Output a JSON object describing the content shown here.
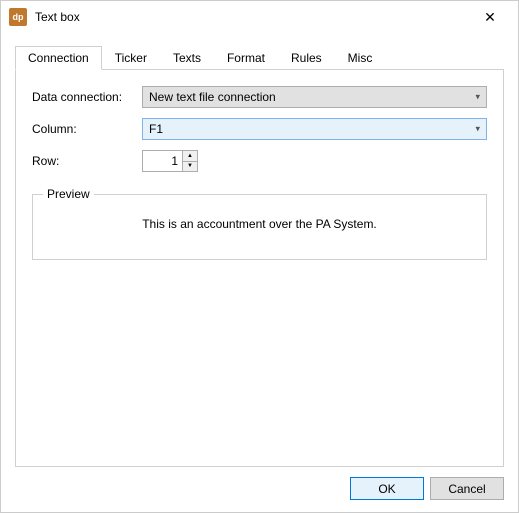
{
  "window": {
    "icon_text": "dp",
    "title": "Text box",
    "close": "✕"
  },
  "tabs": {
    "connection": "Connection",
    "ticker": "Ticker",
    "texts": "Texts",
    "format": "Format",
    "rules": "Rules",
    "misc": "Misc"
  },
  "form": {
    "data_connection_label": "Data connection:",
    "data_connection_value": "New text file connection",
    "column_label": "Column:",
    "column_value": "F1",
    "row_label": "Row:",
    "row_value": "1"
  },
  "preview": {
    "legend": "Preview",
    "text": "This is an accountment over the PA System."
  },
  "buttons": {
    "ok": "OK",
    "cancel": "Cancel"
  }
}
